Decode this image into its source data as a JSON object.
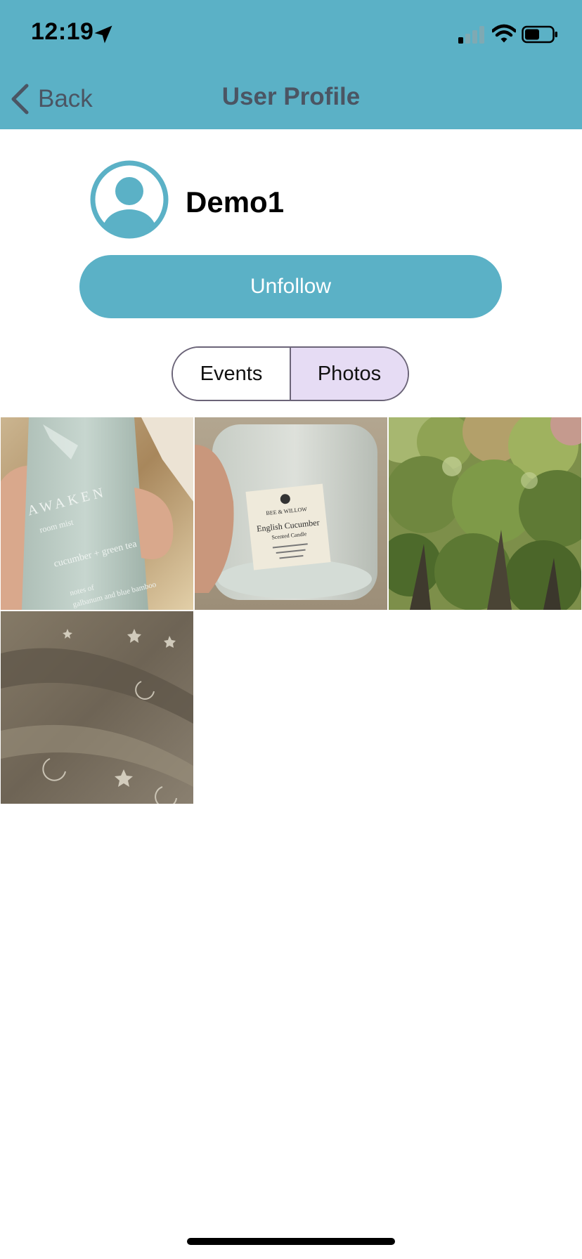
{
  "status_bar": {
    "time": "12:19",
    "icons": [
      "location-arrow-icon",
      "cellular-signal-icon",
      "wifi-icon",
      "battery-icon"
    ]
  },
  "nav": {
    "back_label": "Back",
    "title": "User Profile"
  },
  "profile": {
    "username": "Demo1",
    "avatar_icon": "user-avatar-icon",
    "follow_button_label": "Unfollow"
  },
  "tabs": [
    {
      "label": "Events",
      "selected": false
    },
    {
      "label": "Photos",
      "selected": true
    }
  ],
  "photos": {
    "count": 4,
    "items": [
      {
        "text_lines": [
          "AWAKEN",
          "room mist",
          "cucumber + green tea",
          "notes of",
          "galbanum and blue bamboo"
        ]
      },
      {
        "text_lines": [
          "BEE & WILLOW",
          "English Cucumber",
          "Scented Candle"
        ]
      },
      {
        "text_lines": []
      },
      {
        "text_lines": []
      }
    ]
  },
  "colors": {
    "header_bg": "#5bb1c6",
    "accent": "#5bb1c6",
    "selected_tab_bg": "#e6dcf4",
    "nav_text": "#4b5563"
  }
}
